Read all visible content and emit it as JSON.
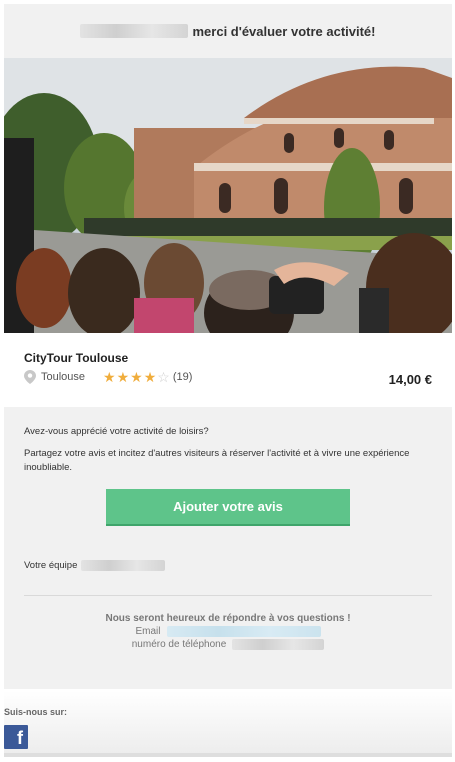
{
  "header": {
    "title": "merci d'évaluer votre activité!"
  },
  "activity": {
    "name": "CityTour Toulouse",
    "city": "Toulouse",
    "rating": 4,
    "rating_max": 5,
    "review_count": "(19)",
    "price": "14,00 €"
  },
  "message": {
    "question": "Avez-vous apprécié votre activité de loisirs?",
    "invite": "Partagez votre avis et incitez d'autres visiteurs à réserver l'activité et à vivre une expérience inoubliable.",
    "cta_label": "Ajouter votre avis",
    "team_label": "Votre équipe"
  },
  "contact": {
    "heading": "Nous seront heureux de répondre à vos questions !",
    "email_label": "Email",
    "phone_label": "numéro de téléphone"
  },
  "footer": {
    "follow_label": "Suis-nous sur:",
    "facebook_glyph": "f"
  },
  "colors": {
    "cta": "#5ec48a",
    "star": "#f0ad3c",
    "facebook": "#3b5998",
    "background": "#f1f1f1"
  },
  "icons": [
    "map-pin-icon",
    "star-icon",
    "facebook-icon"
  ]
}
